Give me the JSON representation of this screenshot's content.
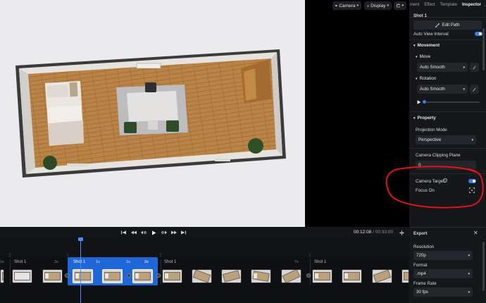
{
  "toolbar": {
    "camera_label": "Camera",
    "display_label": "Display"
  },
  "inspector": {
    "tabs": [
      "ment",
      "Effect",
      "Template",
      "Inspector"
    ],
    "shot_title": "Shot 1",
    "edit_path_label": "Edit Path",
    "auto_view_interval_label": "Auto View Interval",
    "movement_heading": "Movement",
    "move_label": "Move",
    "move_value": "Auto Smooth",
    "rotation_label": "Rotation",
    "rotation_value": "Auto Smooth",
    "property_heading": "Property",
    "projection_mode_label": "Projection Mode",
    "projection_mode_value": "Perspective",
    "clipping_plane_label": "Camera Clipping Plane",
    "clipping_plane_value": "0",
    "camera_target_label": "Camera Target",
    "focus_on_label": "Focus On",
    "accent_color": "#3a7bf3"
  },
  "playback": {
    "current_time": "00:12:08",
    "separator": " / ",
    "total_time": "00:33:00"
  },
  "timeline": {
    "ticks": [
      "1s",
      "2s",
      "1s",
      "1s",
      "2s",
      "7s"
    ],
    "shots": [
      "Shot 1",
      "Shot 1",
      "Shot 1",
      "Shot 1"
    ],
    "selected_color": "#1f66d6"
  },
  "export": {
    "title": "Export",
    "resolution_label": "Resolution",
    "resolution_value": "720p",
    "format_label": "Format",
    "format_value": ".mp4",
    "frame_rate_label": "Frame Rate",
    "frame_rate_value": "30 fps"
  },
  "annotation_color": "#e0141b"
}
